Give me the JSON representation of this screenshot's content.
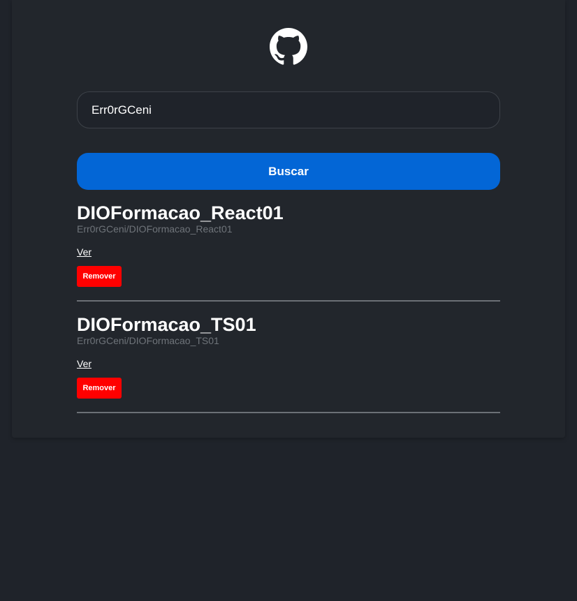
{
  "header": {
    "logo_icon": "github-icon"
  },
  "search": {
    "value": "Err0rGCeni",
    "placeholder": "",
    "button_label": "Buscar"
  },
  "colors": {
    "background": "#1f232a",
    "card": "#22262c",
    "primary_button": "#0366d6",
    "remove_button": "#ff0000"
  },
  "repos": [
    {
      "name": "DIOFormacao_React01",
      "full_name": "Err0rGCeni/DIOFormacao_React01",
      "link_label": "Ver",
      "remove_label": "Remover"
    },
    {
      "name": "DIOFormacao_TS01",
      "full_name": "Err0rGCeni/DIOFormacao_TS01",
      "link_label": "Ver",
      "remove_label": "Remover"
    }
  ]
}
